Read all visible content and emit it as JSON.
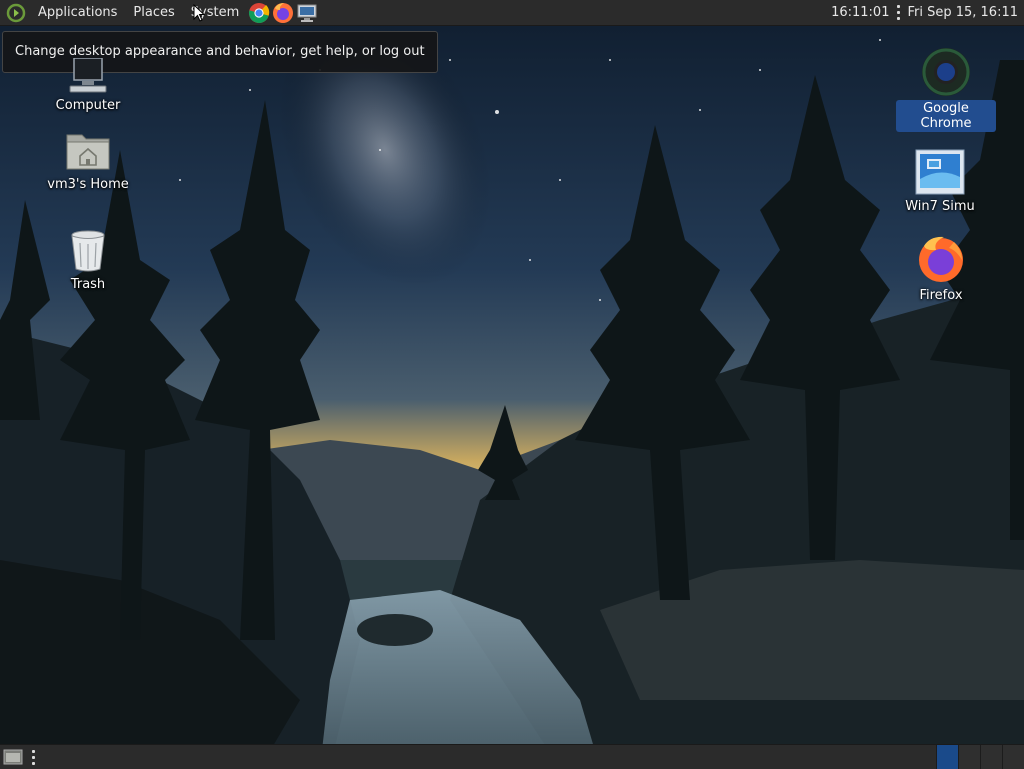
{
  "top_panel": {
    "menus": {
      "applications": "Applications",
      "places": "Places",
      "system": "System"
    },
    "launchers": [
      "chrome-icon",
      "firefox-icon",
      "monitor-icon"
    ],
    "clock": "16:11:01",
    "date": "Fri Sep 15, 16:11"
  },
  "tooltip": {
    "text": "Change desktop appearance and behavior, get help, or log out"
  },
  "desktop": {
    "left_icons": [
      {
        "label": "Computer",
        "icon": "computer-icon"
      },
      {
        "label": "vm3's Home",
        "icon": "home-folder-icon"
      },
      {
        "label": "Trash",
        "icon": "trash-icon"
      }
    ],
    "right_icons": [
      {
        "label": "Google Chrome",
        "icon": "chrome-icon"
      },
      {
        "label": "Win7 Simu",
        "icon": "win7-icon"
      },
      {
        "label": "Firefox",
        "icon": "firefox-icon"
      }
    ]
  },
  "bottom_panel": {
    "workspaces": 4,
    "active_workspace": 1
  },
  "colors": {
    "panel": "#2b2b2b",
    "selection": "#224d8f",
    "active_workspace": "#1a4a8a"
  }
}
